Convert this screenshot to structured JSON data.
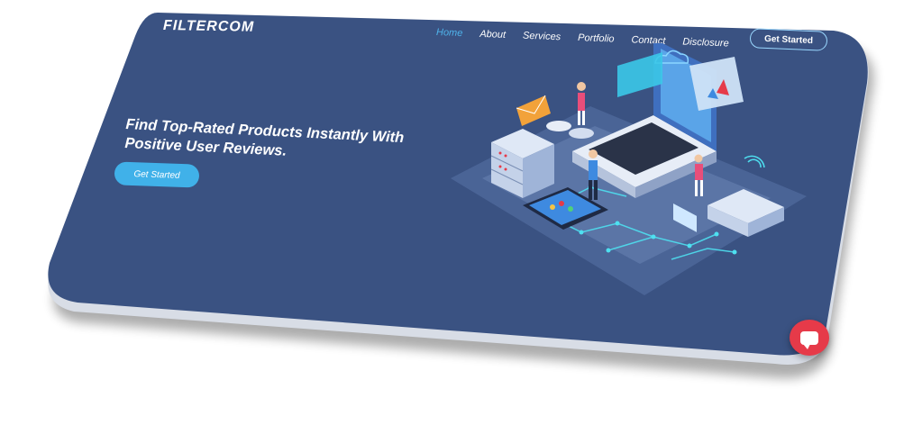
{
  "brand": {
    "logo": "FILTERCOM"
  },
  "nav": {
    "items": [
      {
        "label": "Home",
        "active": true
      },
      {
        "label": "About"
      },
      {
        "label": "Services"
      },
      {
        "label": "Portfolio"
      },
      {
        "label": "Contact"
      },
      {
        "label": "Disclosure"
      }
    ],
    "cta_label": "Get Started"
  },
  "hero": {
    "title": "Find Top-Rated Products Instantly With Positive User Reviews.",
    "cta_label": "Get Started"
  },
  "chat": {
    "icon": "chat-icon"
  },
  "colors": {
    "background": "#3a5282",
    "accent": "#40b1e9",
    "chat": "#e63a49",
    "text": "#ffffff"
  }
}
